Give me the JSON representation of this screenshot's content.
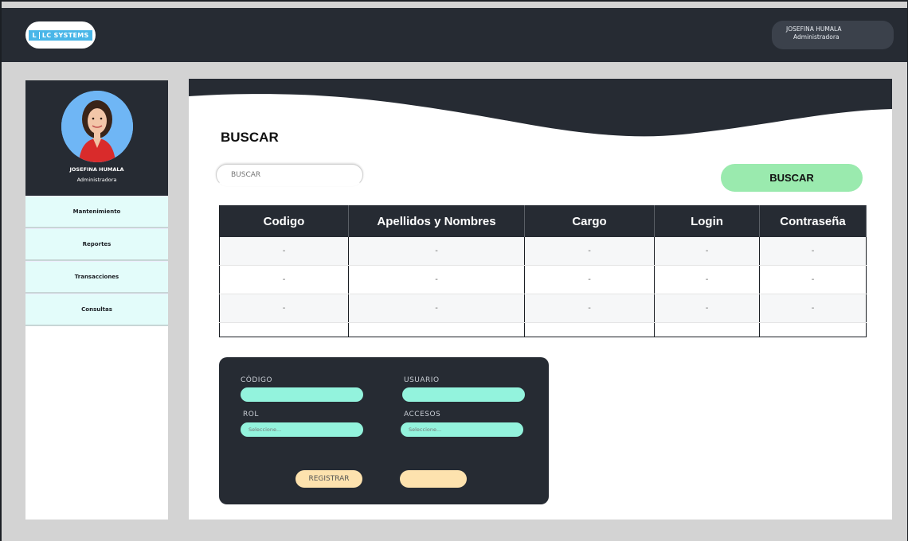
{
  "header": {
    "logo_letter": "L",
    "logo_text": "LC SYSTEMS",
    "user_name": "JOSEFINA HUMALA",
    "user_role": "Administradora"
  },
  "sidebar": {
    "user_name": "JOSEFINA HUMALA",
    "user_role": "Administradora",
    "items": [
      {
        "label": "Mantenimiento"
      },
      {
        "label": "Reportes"
      },
      {
        "label": "Transacciones"
      },
      {
        "label": "Consultas"
      }
    ]
  },
  "main": {
    "title": "BUSCAR",
    "search_placeholder": "BUSCAR",
    "search_button": "BUSCAR",
    "table": {
      "headers": [
        "Codigo",
        "Apellidos y Nombres",
        "Cargo",
        "Login",
        "Contraseña"
      ],
      "rows": [
        [
          "-",
          "-",
          "-",
          "-",
          "-"
        ],
        [
          "-",
          "-",
          "-",
          "-",
          "-"
        ],
        [
          "-",
          "-",
          "-",
          "-",
          "-"
        ]
      ]
    },
    "form": {
      "codigo_label": "CÓDIGO",
      "usuario_label": "USUARIO",
      "rol_label": "ROL",
      "accesos_label": "ACCESOS",
      "rol_placeholder": "Seleccione...",
      "accesos_placeholder": "Seleccione...",
      "register_button": "REGISTRAR",
      "second_button": ""
    }
  },
  "colors": {
    "dark": "#262b33",
    "menu_bg": "#e3fcfa",
    "search_button": "#9aeaae",
    "form_input": "#93f3dd",
    "form_button": "#fde2ae"
  }
}
